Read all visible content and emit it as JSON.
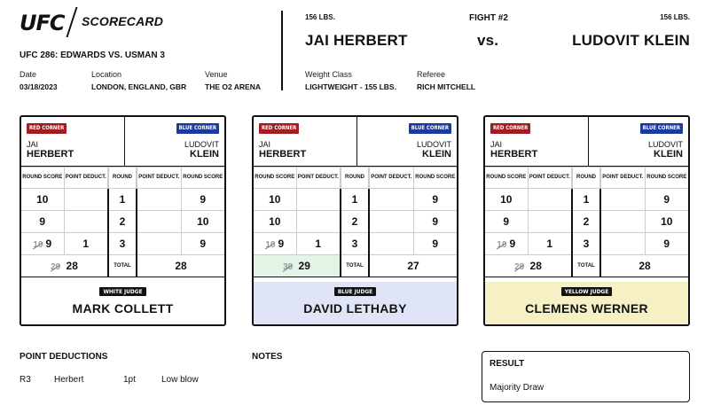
{
  "header": {
    "logo": "UFC",
    "title": "SCORECARD",
    "event": "UFC 286: EDWARDS VS. USMAN 3",
    "date_label": "Date",
    "date": "03/18/2023",
    "location_label": "Location",
    "location": "LONDON, ENGLAND, GBR",
    "venue_label": "Venue",
    "venue": "THE O2 ARENA"
  },
  "fight": {
    "red_weight": "156 LBS.",
    "blue_weight": "156 LBS.",
    "fight_number": "FIGHT #2",
    "red_fighter": "JAI HERBERT",
    "vs": "vs.",
    "blue_fighter": "LUDOVIT KLEIN",
    "weight_class_label": "Weight Class",
    "weight_class": "LIGHTWEIGHT - 155 LBS.",
    "referee_label": "Referee",
    "referee": "RICH MITCHELL"
  },
  "scorecard_labels": {
    "red_corner": "RED CORNER",
    "blue_corner": "BLUE CORNER",
    "red_first": "JAI",
    "red_last": "HERBERT",
    "blue_first": "LUDOVIT",
    "blue_last": "KLEIN",
    "round_score": "ROUND SCORE",
    "point_deduct": "POINT DEDUCT.",
    "round": "ROUND",
    "total": "TOTAL"
  },
  "cards": [
    {
      "judge_label": "WHITE JUDGE",
      "judge_name": "MARK COLLETT",
      "bg": "#ffffff",
      "rounds": [
        {
          "red_struck": "",
          "red": "10",
          "red_ded": "",
          "num": "1",
          "blue_ded": "",
          "blue": "9"
        },
        {
          "red_struck": "",
          "red": "9",
          "red_ded": "",
          "num": "2",
          "blue_ded": "",
          "blue": "10"
        },
        {
          "red_struck": "10",
          "red": "9",
          "red_ded": "1",
          "num": "3",
          "blue_ded": "",
          "blue": "9"
        }
      ],
      "red_total_struck": "29",
      "red_total": "28",
      "blue_total": "28"
    },
    {
      "judge_label": "BLUE JUDGE",
      "judge_name": "DAVID LETHABY",
      "bg": "#dfe5f7",
      "rounds": [
        {
          "red_struck": "",
          "red": "10",
          "red_ded": "",
          "num": "1",
          "blue_ded": "",
          "blue": "9"
        },
        {
          "red_struck": "",
          "red": "10",
          "red_ded": "",
          "num": "2",
          "blue_ded": "",
          "blue": "9"
        },
        {
          "red_struck": "10",
          "red": "9",
          "red_ded": "1",
          "num": "3",
          "blue_ded": "",
          "blue": "9"
        }
      ],
      "red_total_struck": "30",
      "red_total": "29",
      "blue_total": "27"
    },
    {
      "judge_label": "YELLOW JUDGE",
      "judge_name": "CLEMENS WERNER",
      "bg": "#f7f0c4",
      "rounds": [
        {
          "red_struck": "",
          "red": "10",
          "red_ded": "",
          "num": "1",
          "blue_ded": "",
          "blue": "9"
        },
        {
          "red_struck": "",
          "red": "9",
          "red_ded": "",
          "num": "2",
          "blue_ded": "",
          "blue": "10"
        },
        {
          "red_struck": "10",
          "red": "9",
          "red_ded": "1",
          "num": "3",
          "blue_ded": "",
          "blue": "9"
        }
      ],
      "red_total_struck": "29",
      "red_total": "28",
      "blue_total": "28"
    }
  ],
  "point_deductions": {
    "title": "POINT DEDUCTIONS",
    "items": [
      {
        "round": "R3",
        "fighter": "Herbert",
        "points": "1pt",
        "reason": "Low blow"
      }
    ]
  },
  "notes": {
    "title": "NOTES"
  },
  "result": {
    "title": "RESULT",
    "value": "Majority Draw"
  }
}
